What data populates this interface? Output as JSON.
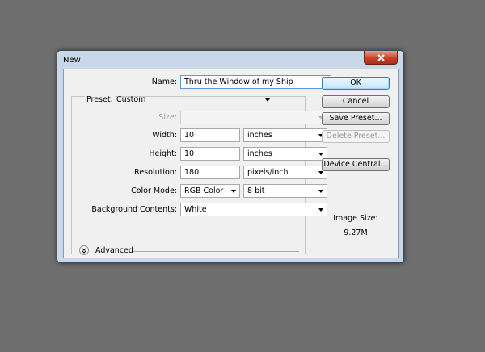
{
  "dialog": {
    "title": "New",
    "close_icon": "close-icon"
  },
  "form": {
    "name_label": "Name:",
    "name_value": "Thru the Window of my Ship",
    "preset_label": "Preset:",
    "preset_value": "Custom",
    "size_label": "Size:",
    "size_value": "",
    "width_label": "Width:",
    "width_value": "10",
    "width_unit": "inches",
    "height_label": "Height:",
    "height_value": "10",
    "height_unit": "inches",
    "resolution_label": "Resolution:",
    "resolution_value": "180",
    "resolution_unit": "pixels/inch",
    "color_mode_label": "Color Mode:",
    "color_mode_value": "RGB Color",
    "bit_depth_value": "8 bit",
    "background_label": "Background Contents:",
    "background_value": "White",
    "advanced_label": "Advanced"
  },
  "buttons": {
    "ok": "OK",
    "cancel": "Cancel",
    "save_preset": "Save Preset...",
    "delete_preset": "Delete Preset...",
    "device_central": "Device Central..."
  },
  "info": {
    "image_size_label": "Image Size:",
    "image_size_value": "9.27M"
  },
  "colors": {
    "desktop": "#6e6e6e",
    "dialog_frame": "#c9d8e8",
    "close_button": "#c7432a",
    "client_bg": "#f0f0f0"
  }
}
